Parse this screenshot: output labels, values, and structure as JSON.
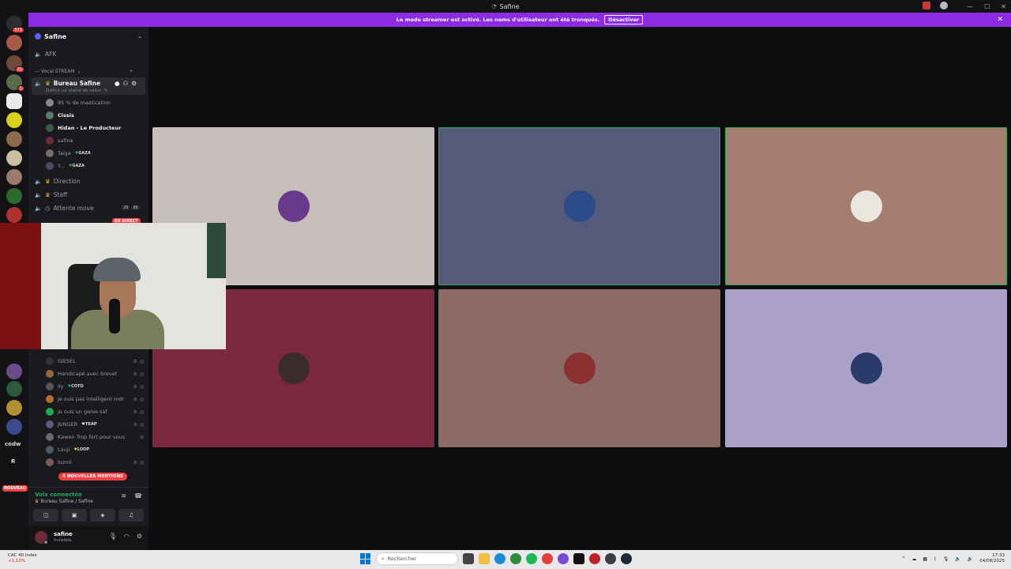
{
  "window": {
    "title": "Safine"
  },
  "banner": {
    "message": "Le mode streamer est activé. Les noms d'utilisateur ont été tronqués.",
    "button": "Désactiver"
  },
  "rail": {
    "text1": "codw",
    "text2": "R",
    "nouveau": "NOUVEAU"
  },
  "guild": {
    "name": "Safine"
  },
  "channels": {
    "afk": "AFK",
    "category": "— Vocal STREAM",
    "active": "Bureau Safine",
    "active_status": "Définir un statut de salon",
    "direction": "Direction",
    "staff": "Staff",
    "attente": "Attente move",
    "attente_count1": "29",
    "attente_count2": "99",
    "live": "EN DIRECT"
  },
  "users_top": [
    {
      "name": "95 % de mastication",
      "tag": ""
    },
    {
      "name": "Cissis",
      "tag": ""
    },
    {
      "name": "Hidan - Le Producteur",
      "tag": ""
    },
    {
      "name": "safine",
      "tag": ""
    },
    {
      "name": "Taiga",
      "tag": "GAZA"
    },
    {
      "name": "Y...",
      "tag": "GAZA"
    }
  ],
  "users_bottom": [
    {
      "name": "GIESEL",
      "tag": ""
    },
    {
      "name": "Handicapé avec brevet",
      "tag": ""
    },
    {
      "name": "Ily",
      "tag": "COTO"
    },
    {
      "name": "Je suis pas intelligent mdr",
      "tag": ""
    },
    {
      "name": "je suis un genie saf",
      "tag": ""
    },
    {
      "name": "JUNGER",
      "tag": "TRAP"
    },
    {
      "name": "Kawen Trop fort pour vous",
      "tag": ""
    },
    {
      "name": "Lauji",
      "tag": "LOOP"
    },
    {
      "name": "luzrol",
      "tag": ""
    }
  ],
  "mentions": "4 NOUVELLES MENTIONS",
  "voice": {
    "title": "Voix connectée",
    "channel": "Bureau Safine / Safine"
  },
  "user": {
    "name": "safine",
    "status": "Invisible"
  },
  "taskbar": {
    "stock_name": "CAC 40 index",
    "stock_change": "+1,10%",
    "search": "Rechercher",
    "time": "17:33",
    "date": "04/08/2025"
  },
  "colors": {
    "banner": "#8b2be2",
    "speaking": "#23a55a",
    "tiles": [
      "#c7bdbb",
      "#545a7a",
      "#a57e70",
      "#7a2840",
      "#8e6a66",
      "#aba1c8"
    ]
  }
}
